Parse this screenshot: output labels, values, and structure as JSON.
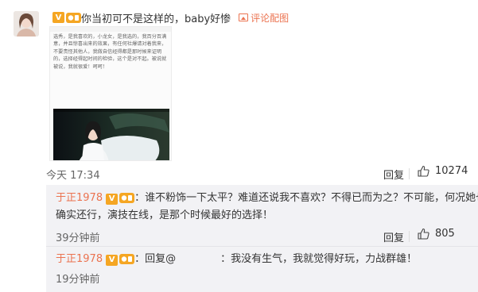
{
  "comment": {
    "username": "",
    "verified_badge": "V",
    "text": "你当初可不是这样的，baby好惨",
    "image_link_label": "评论配图",
    "time": "今天 17:34",
    "reply_label": "回复",
    "like_count": "10274"
  },
  "embedded_post": {
    "text": "选秀，是我喜欢的，小龙女，是我选的，我百分百满意，并且惊喜出来的效果，有任何社爆请对着我来，不要责怪其他人，我做自信经得都是那时候来证明的，选择经得起时间的检验，这个是对不起。被说就被说，我就很爱！呵呵！",
    "photo_alt": "剧照"
  },
  "replies": [
    {
      "username": "于正1978",
      "verified_badge": "V",
      "text_line1": "：谁不粉饰一下太平？难道还说我不喜欢？不得已而为之？不可能，何况她也",
      "text_line2": "确实还行，演技在线，是那个时候最好的选择！",
      "time": "39分钟前",
      "reply_label": "回复",
      "like_count": "805"
    },
    {
      "username": "于正1978",
      "verified_badge": "V",
      "reply_prefix": "：回复@",
      "text": "：我没有生气，我就觉得好玩，力战群雄！",
      "time": "19分钟前"
    }
  ],
  "colors": {
    "username": "#eb7350",
    "badge": "#f5a623",
    "panel_bg": "#f2f2f5"
  },
  "icons": [
    "verified-v-icon",
    "fan-badge-icon",
    "image-icon",
    "thumbs-up-icon"
  ]
}
